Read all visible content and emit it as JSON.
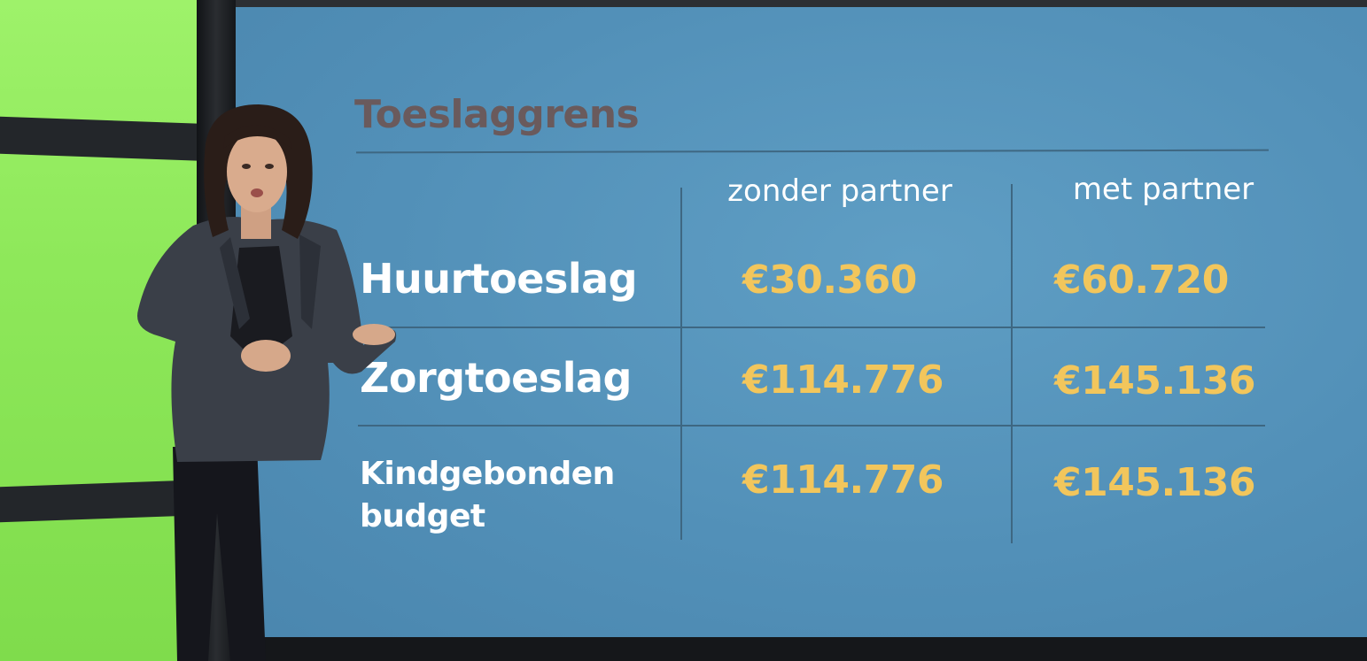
{
  "title": "Toeslaggrens",
  "columns": [
    "zonder partner",
    "met partner"
  ],
  "rows": [
    {
      "label": "Huurtoeslag",
      "values": [
        "€30.360",
        "€60.720"
      ]
    },
    {
      "label": "Zorgtoeslag",
      "values": [
        "€114.776",
        "€145.136"
      ]
    },
    {
      "label": "Kindgebonden budget",
      "values": [
        "€114.776",
        "€145.136"
      ]
    }
  ],
  "colors": {
    "screen": "#5290b8",
    "value_text": "#f2c65c",
    "title_text": "#6a5a5c",
    "label_text": "#ffffff",
    "wall": "#8ee85a"
  }
}
